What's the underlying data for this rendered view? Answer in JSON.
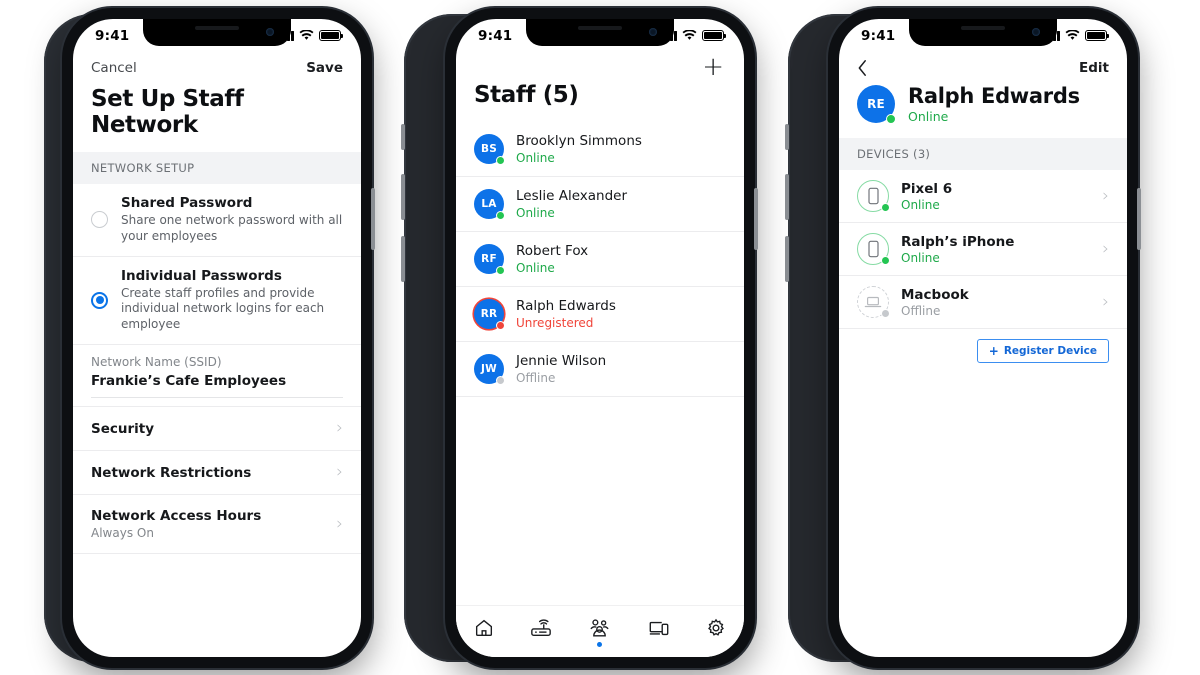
{
  "statusbar": {
    "time": "9:41",
    "signal_icon": "cellular-bars-icon",
    "wifi_icon": "wifi-icon",
    "battery_icon": "battery-icon"
  },
  "colors": {
    "accent": "#0a74e8",
    "online": "#1fa94a",
    "alert": "#f0453a",
    "offline": "#9a9ea3",
    "avatar_bg": "#0d72e8"
  },
  "phone1": {
    "nav": {
      "cancel": "Cancel",
      "save": "Save"
    },
    "title": "Set Up Staff Network",
    "section_label": "NETWORK SETUP",
    "options": [
      {
        "title": "Shared Password",
        "desc": "Share one network password with all your employees",
        "selected": false
      },
      {
        "title": "Individual Passwords",
        "desc": "Create staff profiles and provide individual network logins for each employee",
        "selected": true
      }
    ],
    "ssid": {
      "label": "Network Name (SSID)",
      "value": "Frankie’s Cafe Employees"
    },
    "links": [
      {
        "title": "Security",
        "sub": ""
      },
      {
        "title": "Network Restrictions",
        "sub": ""
      },
      {
        "title": "Network Access Hours",
        "sub": "Always On"
      }
    ]
  },
  "phone2": {
    "add_icon": "plus-icon",
    "title": "Staff (5)",
    "staff": [
      {
        "initials": "BS",
        "name": "Brooklyn Simmons",
        "status": "Online",
        "state": "online"
      },
      {
        "initials": "LA",
        "name": "Leslie Alexander",
        "status": "Online",
        "state": "online"
      },
      {
        "initials": "RF",
        "name": "Robert Fox",
        "status": "Online",
        "state": "online"
      },
      {
        "initials": "RR",
        "name": "Ralph Edwards",
        "status": "Unregistered",
        "state": "alert"
      },
      {
        "initials": "JW",
        "name": "Jennie Wilson",
        "status": "Offline",
        "state": "offline"
      }
    ],
    "tabs": [
      {
        "icon": "home-icon",
        "active": false
      },
      {
        "icon": "router-icon",
        "active": false
      },
      {
        "icon": "people-icon",
        "active": true
      },
      {
        "icon": "devices-icon",
        "active": false
      },
      {
        "icon": "gear-icon",
        "active": false
      }
    ]
  },
  "phone3": {
    "nav": {
      "back_icon": "chevron-left-icon",
      "edit": "Edit"
    },
    "profile": {
      "initials": "RE",
      "name": "Ralph Edwards",
      "status": "Online"
    },
    "section_label": "DEVICES (3)",
    "devices": [
      {
        "icon": "phone-icon",
        "name": "Pixel 6",
        "status": "Online",
        "state": "online"
      },
      {
        "icon": "phone-icon",
        "name": "Ralph’s iPhone",
        "status": "Online",
        "state": "online"
      },
      {
        "icon": "laptop-icon",
        "name": "Macbook",
        "status": "Offline",
        "state": "offline"
      }
    ],
    "register_button": {
      "icon": "plus-icon",
      "label": "Register Device"
    }
  }
}
